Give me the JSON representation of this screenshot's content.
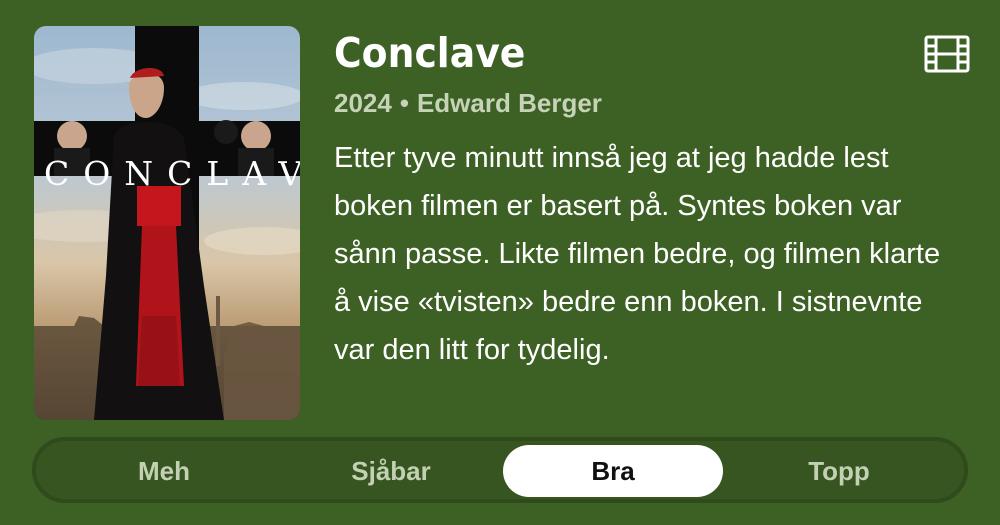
{
  "movie": {
    "title": "Conclave",
    "year": "2024",
    "separator": "•",
    "director": "Edward Berger",
    "poster_title": "CONCLAVE",
    "review": "Etter tyve minutt innså jeg at jeg hadde lest boken filmen er basert på. Syntes boken var sånn passe. Likte filmen bedre, og filmen klarte å vise «tvisten» bedre enn boken. I sistnevnte var den litt for tydelig.",
    "type_icon": "film-icon"
  },
  "rating": {
    "options": [
      "Meh",
      "Sjåbar",
      "Bra",
      "Topp"
    ],
    "selected": "Bra"
  },
  "colors": {
    "background": "#3d6024",
    "segment_track": "#365520",
    "selected_segment": "#ffffff",
    "muted_text": "#c7d3b8"
  }
}
